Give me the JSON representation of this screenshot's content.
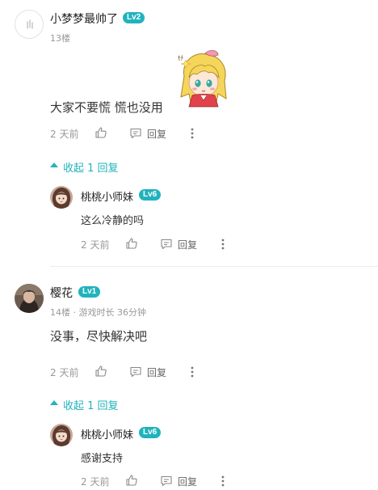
{
  "comments": [
    {
      "username": "小梦梦最帅了",
      "level": "Lv2",
      "meta": "13楼",
      "content": "大家不要慌 慌也没用",
      "time": "2 天前",
      "reply_label": "回复",
      "collapse_label": "收起 1 回复",
      "reply": {
        "username": "桃桃小师妹",
        "level": "Lv6",
        "content": "这么冷静的吗",
        "time": "2 天前",
        "reply_label": "回复"
      }
    },
    {
      "username": "樱花",
      "level": "Lv1",
      "meta": "14楼 · 游戏时长 36分钟",
      "content": "没事，尽快解决吧",
      "time": "2 天前",
      "reply_label": "回复",
      "collapse_label": "收起 1 回复",
      "reply": {
        "username": "桃桃小师妹",
        "level": "Lv6",
        "content": "感谢支持",
        "time": "2 天前",
        "reply_label": "回复"
      }
    }
  ],
  "icons": {
    "like": "thumbs-up-icon",
    "reply": "comment-bubble-icon",
    "more": "more-vertical-icon",
    "collapse": "caret-up-icon",
    "sticker": "anime-girl-sticker"
  },
  "colors": {
    "accent": "#21b3bd",
    "meta": "#999999",
    "text": "#333333",
    "divider": "#ececec"
  }
}
